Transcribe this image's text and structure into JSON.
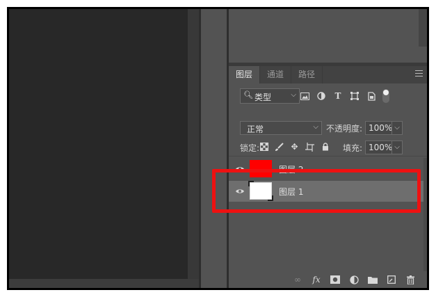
{
  "tabs": [
    {
      "label": "图层",
      "active": true
    },
    {
      "label": "通道",
      "active": false
    },
    {
      "label": "路径",
      "active": false
    }
  ],
  "filter": {
    "kind_label": "类型",
    "icons": [
      "image-filter-icon",
      "adjustment-filter-icon",
      "text-filter-icon",
      "shape-filter-icon",
      "smart-object-filter-icon"
    ]
  },
  "blend": {
    "mode": "正常",
    "opacity_label": "不透明度:",
    "opacity_value": "100%"
  },
  "lock": {
    "label": "锁定:",
    "fill_label": "填充:",
    "fill_value": "100%"
  },
  "layers": [
    {
      "name": "图层 2",
      "thumb_color": "#ff0000",
      "selected": false
    },
    {
      "name": "图层 1",
      "thumb_color": "#ffffff",
      "selected": true
    }
  ],
  "colors": {
    "highlight": "#ee1111",
    "panel": "#535353",
    "canvas": "#282828"
  },
  "bottom_icons": [
    "link-layers-icon",
    "fx-icon",
    "add-mask-icon",
    "adjustment-layer-icon",
    "new-group-icon",
    "new-layer-icon",
    "delete-layer-icon"
  ]
}
